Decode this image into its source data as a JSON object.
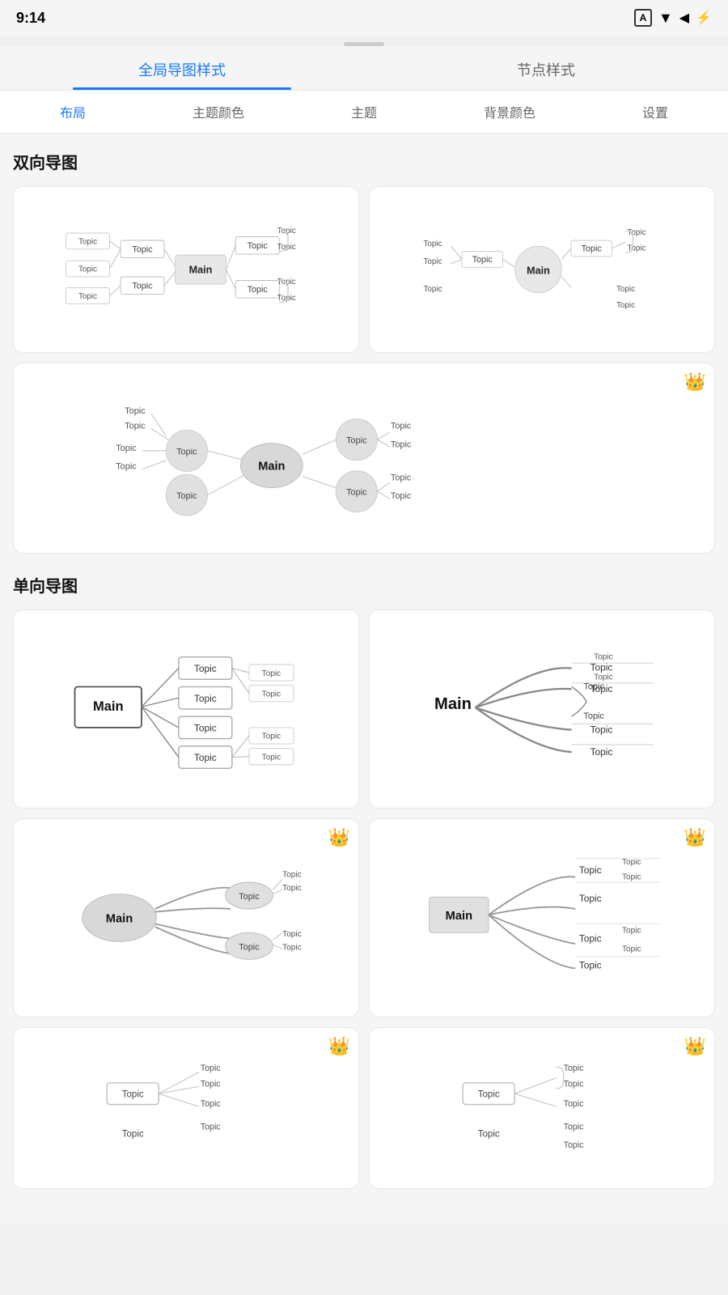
{
  "statusBar": {
    "time": "9:14",
    "icons": [
      "A",
      "wifi",
      "signal",
      "battery"
    ]
  },
  "topTabs": [
    {
      "id": "global",
      "label": "全局导图样式",
      "active": true
    },
    {
      "id": "node",
      "label": "节点样式",
      "active": false
    }
  ],
  "subTabs": [
    {
      "id": "layout",
      "label": "布局",
      "active": true
    },
    {
      "id": "theme-color",
      "label": "主题颜色",
      "active": false
    },
    {
      "id": "theme",
      "label": "主题",
      "active": false
    },
    {
      "id": "bg-color",
      "label": "背景颜色",
      "active": false
    },
    {
      "id": "settings",
      "label": "设置",
      "active": false
    }
  ],
  "sections": [
    {
      "id": "bidirectional",
      "title": "双向导图",
      "cards": [
        {
          "id": "bd1",
          "type": "bidirectional-rect",
          "premium": false
        },
        {
          "id": "bd2",
          "type": "bidirectional-circle",
          "premium": false
        },
        {
          "id": "bd3",
          "type": "bidirectional-circle-large",
          "premium": true,
          "fullWidth": true
        }
      ]
    },
    {
      "id": "unidirectional",
      "title": "单向导图",
      "cards": [
        {
          "id": "ud1",
          "type": "unidirectional-rect",
          "premium": false
        },
        {
          "id": "ud2",
          "type": "unidirectional-curve",
          "premium": false
        },
        {
          "id": "ud3",
          "type": "unidirectional-ellipse-curve",
          "premium": true
        },
        {
          "id": "ud4",
          "type": "unidirectional-rect-curve",
          "premium": true
        },
        {
          "id": "ud5",
          "type": "unidirectional-rect-bottom",
          "premium": true
        },
        {
          "id": "ud6",
          "type": "unidirectional-rect-bottom2",
          "premium": true
        }
      ]
    }
  ],
  "labels": {
    "main": "Main",
    "topic": "Topic",
    "crown": "👑"
  }
}
